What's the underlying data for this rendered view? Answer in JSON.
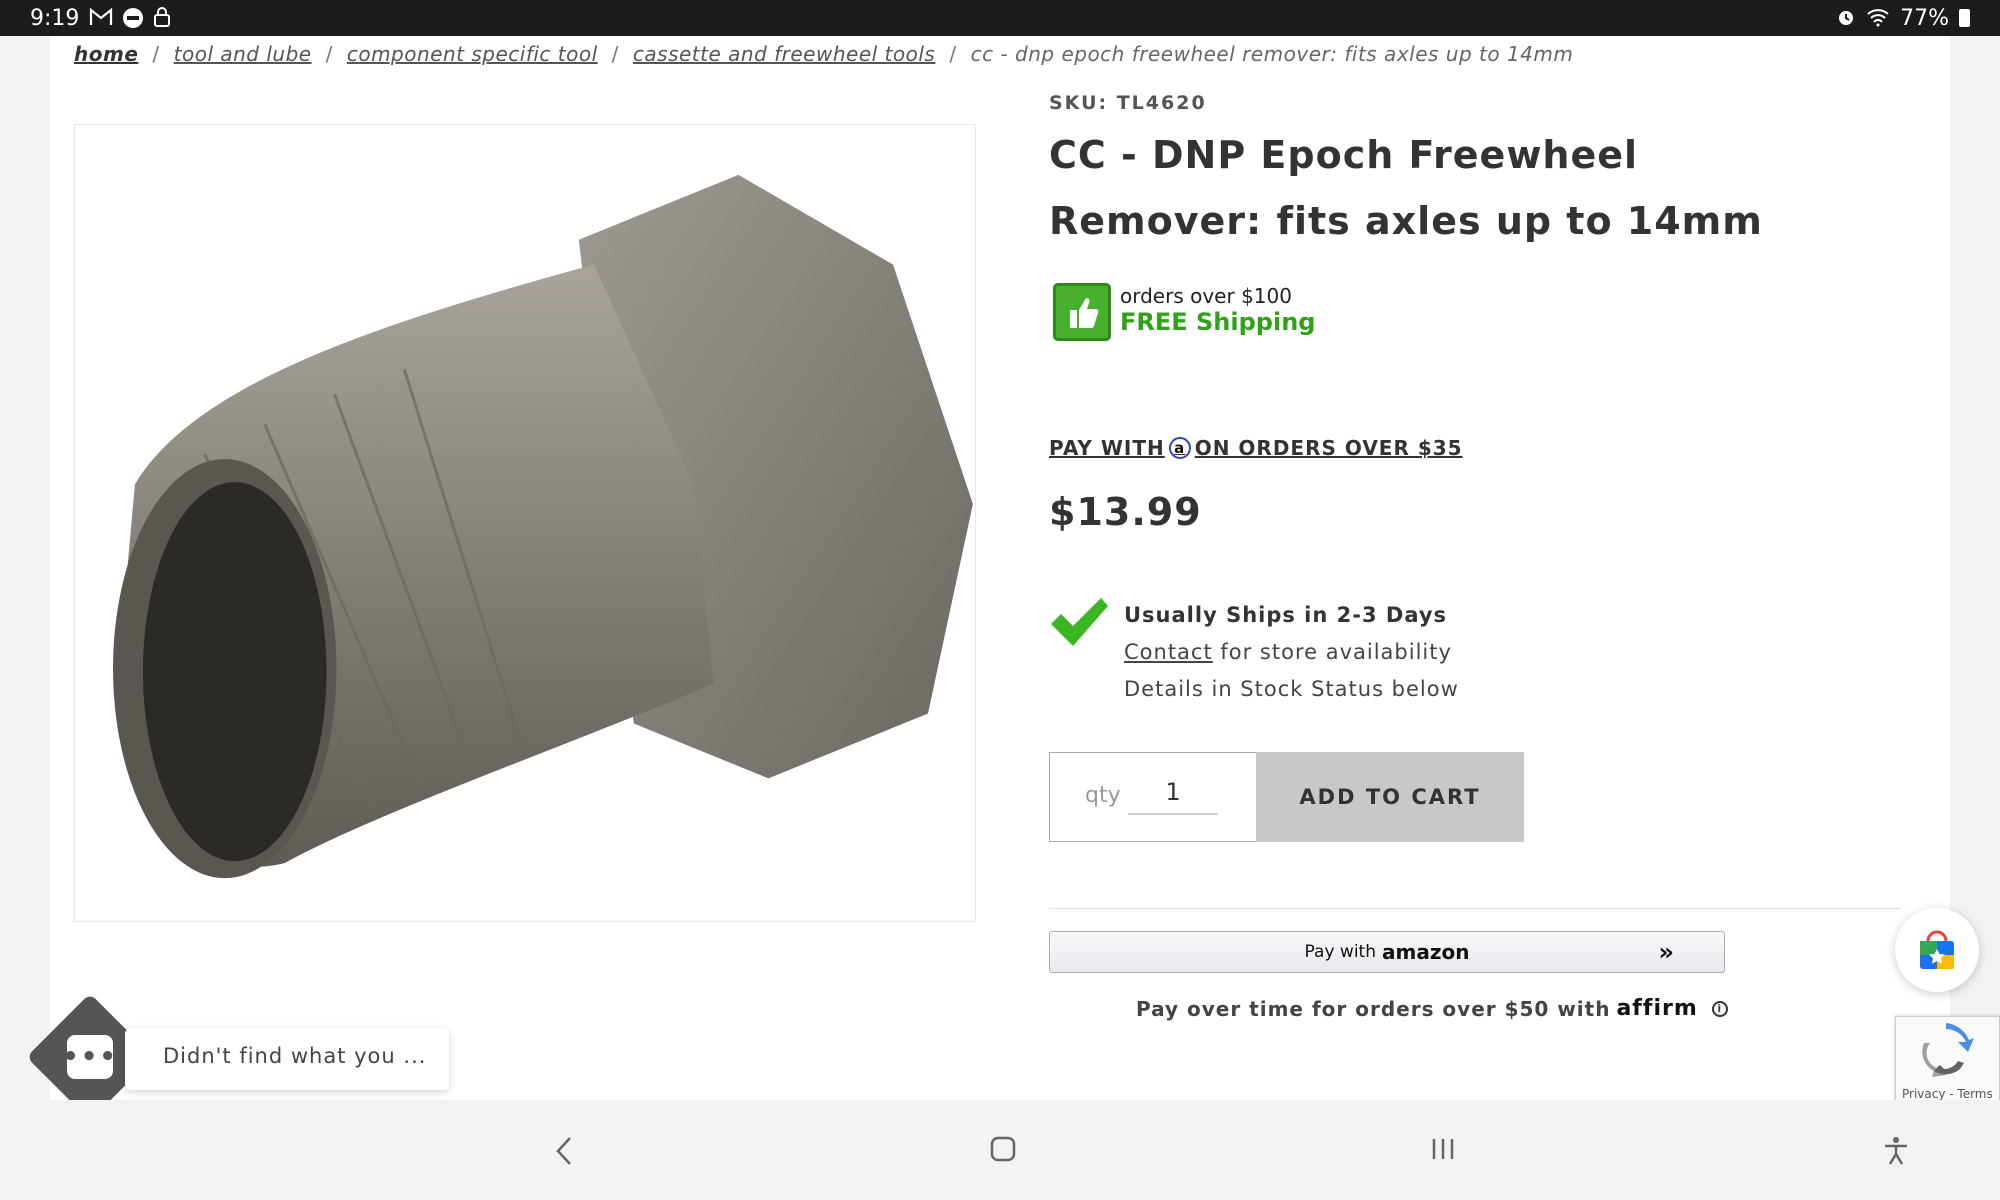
{
  "status_bar": {
    "time": "9:19",
    "left_icons": [
      "gmail-icon",
      "do-not-disturb-icon",
      "lock-icon"
    ],
    "right_icons": [
      "alarm-icon",
      "wifi-icon",
      "battery-icon"
    ],
    "battery": "77%"
  },
  "breadcrumb": {
    "items": [
      "home",
      "tool and lube",
      "component specific tool",
      "cassette and freewheel tools"
    ],
    "separator": "/",
    "current": "cc - dnp epoch freewheel remover: fits axles up to 14mm"
  },
  "product": {
    "sku": "SKU: TL4620",
    "title": "CC - DNP Epoch Freewheel Remover: fits axles up to 14mm",
    "image_alt": "freewheel remover tool",
    "shipping_badge": {
      "line1": "orders over $100",
      "line2": "FREE Shipping"
    },
    "pay_amazon": {
      "prefix": "PAY WITH",
      "logo": "a",
      "suffix": "ON ORDERS OVER $35"
    },
    "price": "$13.99",
    "availability": {
      "headline": "Usually Ships in 2-3 Days",
      "contact_link": "Contact",
      "contact_rest": " for store availability",
      "details": "Details in Stock Status below"
    },
    "qty": {
      "label": "qty",
      "value": "1"
    },
    "add_to_cart": "ADD TO CART",
    "amazon_button": {
      "pay_with": "Pay with",
      "brand": "amazon",
      "chevron": "»"
    },
    "affirm": {
      "text": "Pay over time for orders over $50 with",
      "brand": "affirm",
      "info": "i"
    }
  },
  "chat": {
    "bubble_text": "Didn't find what you ...",
    "icon_text": "•••"
  },
  "recaptcha": {
    "links": "Privacy - Terms"
  },
  "colors": {
    "status_bar": "#1c1c1c",
    "free_shipping_green": "#2fa21a",
    "add_to_cart_bg": "#c8c8c8",
    "check_green": "#3cb521"
  }
}
